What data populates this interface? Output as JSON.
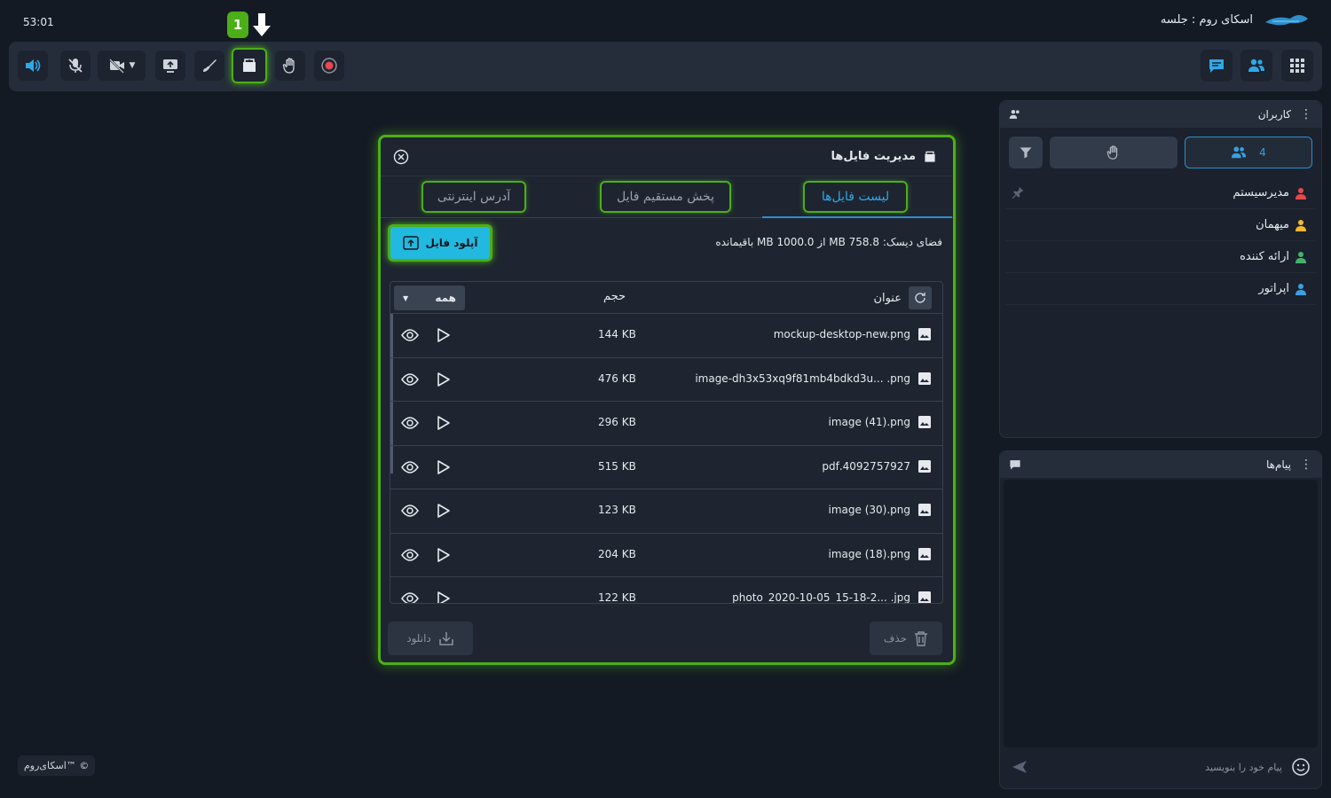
{
  "timer": "53:01",
  "room": {
    "title": "اسکای روم : جلسه"
  },
  "marker": {
    "number": "1"
  },
  "toolbar": {
    "left": [
      "speaker-icon",
      "mic-muted-icon",
      "camera-off-icon",
      "screen-share-icon",
      "brush-icon",
      "file-manager-icon",
      "raise-hand-icon",
      "record-icon"
    ],
    "right": [
      "chat-icon",
      "users-icon",
      "apps-grid-icon"
    ]
  },
  "users_panel": {
    "title": "کاربران",
    "count": "4",
    "users": [
      {
        "name": "مدیرسیستم",
        "color": "#e5484d",
        "pinned": true
      },
      {
        "name": "میهمان",
        "color": "#f5b82e",
        "pinned": false
      },
      {
        "name": "ارائه کننده",
        "color": "#45b26b",
        "pinned": false
      },
      {
        "name": "اپراتور",
        "color": "#3aa0e0",
        "pinned": false
      }
    ]
  },
  "messages_panel": {
    "title": "پیام‌ها",
    "input_placeholder": "پیام خود را بنویسید"
  },
  "copyright": "اسکای‌روم™ ©",
  "modal": {
    "title": "مدیریت فایل‌ها",
    "tabs": [
      "لیست فایل‌ها",
      "پخش مستقیم فایل",
      "آدرس اینترنتی"
    ],
    "active_tab": "لیست فایل‌ها",
    "upload_label": "آپلود فایل",
    "disk_info": "فضای دیسک: 758.8 MB از 1000.0 MB باقیمانده",
    "columns": {
      "title": "عنوان",
      "size": "حجم",
      "filter": "همه"
    },
    "files": [
      {
        "name": "mockup-desktop-new.png",
        "size": "144 KB"
      },
      {
        "name": "image-dh3x53xq9f81mb4bdkd3u... .png",
        "size": "476 KB"
      },
      {
        "name": "image (41).png",
        "size": "296 KB"
      },
      {
        "name": "4092757927.pdf",
        "size": "515 KB"
      },
      {
        "name": "image (30).png",
        "size": "123 KB"
      },
      {
        "name": "image (18).png",
        "size": "204 KB"
      },
      {
        "name": "photo_2020-10-05_15-18-2... .jpg",
        "size": "122 KB"
      }
    ],
    "download_label": "دانلود",
    "delete_label": "حذف"
  },
  "colors": {
    "accent_green": "#4caf17",
    "accent_blue": "#22b9e0",
    "background": "#141a24"
  }
}
